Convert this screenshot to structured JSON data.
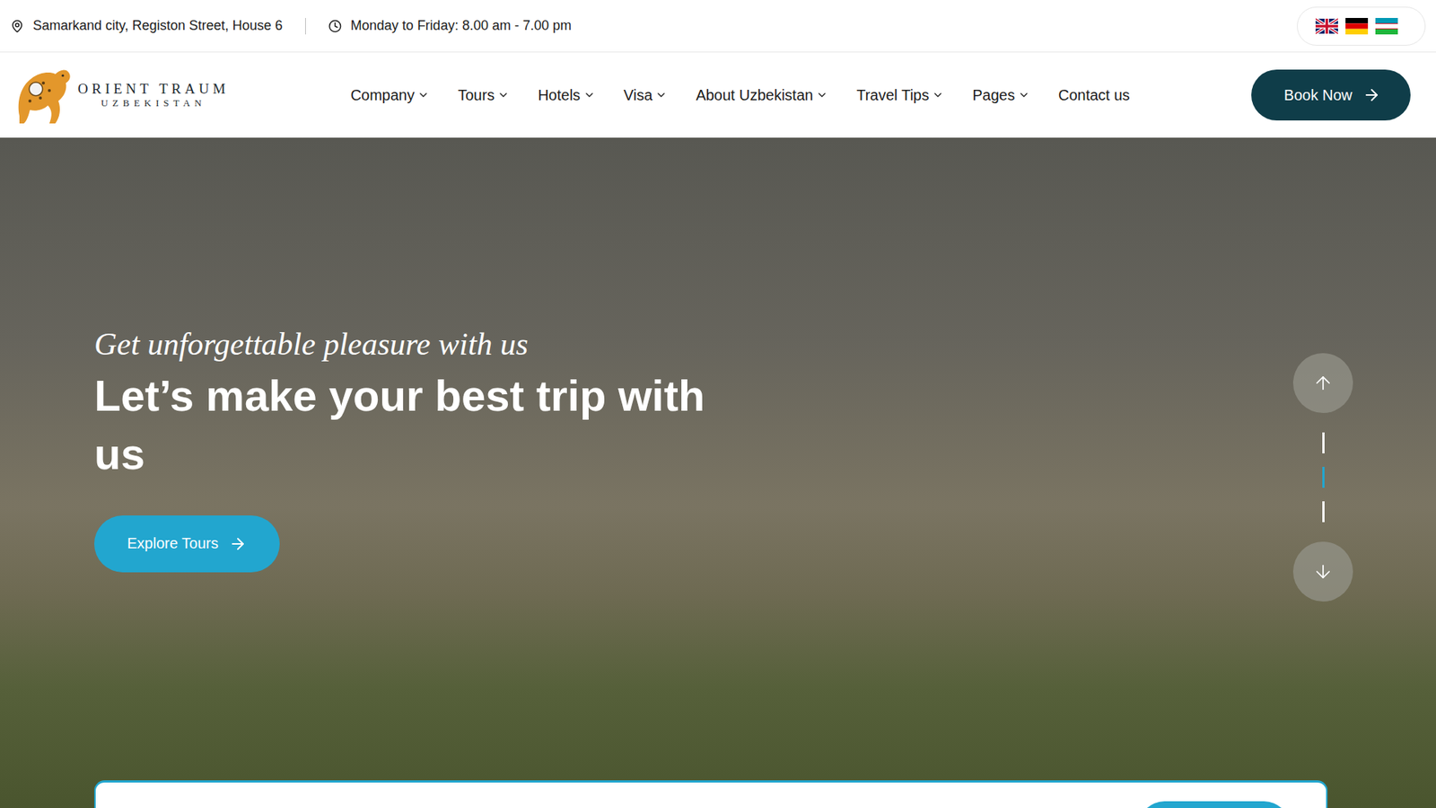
{
  "topbar": {
    "address": "Samarkand city, Registon Street, House 6",
    "hours": "Monday to Friday: 8.00 am - 7.00 pm"
  },
  "logo": {
    "name": "ORIENT TRAUM",
    "sub": "UZBEKISTAN"
  },
  "nav": [
    {
      "label": "Company",
      "dropdown": true
    },
    {
      "label": "Tours",
      "dropdown": true
    },
    {
      "label": "Hotels",
      "dropdown": true
    },
    {
      "label": "Visa",
      "dropdown": true
    },
    {
      "label": "About Uzbekistan",
      "dropdown": true
    },
    {
      "label": "Travel Tips",
      "dropdown": true
    },
    {
      "label": "Pages",
      "dropdown": true
    },
    {
      "label": "Contact us",
      "dropdown": false
    }
  ],
  "book_button": "Book Now",
  "hero": {
    "tagline": "Get unforgettable pleasure with us",
    "title": "Let’s make your best trip with us",
    "button": "Explore Tours"
  },
  "slides": [
    {
      "selected": false
    },
    {
      "selected": true
    },
    {
      "selected": false
    }
  ]
}
